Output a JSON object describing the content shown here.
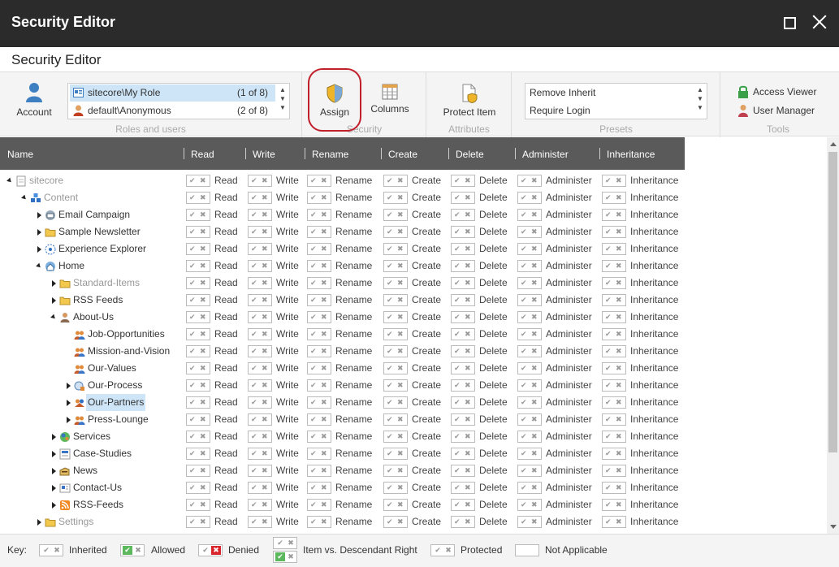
{
  "window": {
    "title": "Security Editor",
    "subtitle": "Security Editor"
  },
  "ribbon": {
    "account_label": "Account",
    "roles": [
      {
        "name": "sitecore\\My Role",
        "count": "(1 of 8)"
      },
      {
        "name": "default\\Anonymous",
        "count": "(2 of 8)"
      }
    ],
    "roles_group_label": "Roles and users",
    "assign_label": "Assign",
    "columns_label": "Columns",
    "security_group_label": "Security",
    "protect_item_label": "Protect Item",
    "attributes_group_label": "Attributes",
    "presets": [
      "Remove Inherit",
      "Require Login"
    ],
    "presets_group_label": "Presets",
    "access_viewer_label": "Access Viewer",
    "user_manager_label": "User Manager",
    "tools_group_label": "Tools"
  },
  "grid": {
    "headers": [
      "Name",
      "Read",
      "Write",
      "Rename",
      "Create",
      "Delete",
      "Administer",
      "Inheritance"
    ],
    "rows": [
      {
        "label": "sitecore",
        "depth": 0,
        "expander": "open",
        "icon": "document-icon",
        "style": "gray"
      },
      {
        "label": "Content",
        "depth": 1,
        "expander": "open",
        "icon": "content-tree-icon",
        "style": "gray"
      },
      {
        "label": "Email Campaign",
        "depth": 2,
        "expander": "closed",
        "icon": "email-icon",
        "style": "normal"
      },
      {
        "label": "Sample Newsletter",
        "depth": 2,
        "expander": "closed",
        "icon": "folder-icon",
        "style": "normal"
      },
      {
        "label": "Experience Explorer",
        "depth": 2,
        "expander": "closed",
        "icon": "explorer-icon",
        "style": "normal"
      },
      {
        "label": "Home",
        "depth": 2,
        "expander": "open",
        "icon": "home-icon",
        "style": "normal"
      },
      {
        "label": "Standard-Items",
        "depth": 3,
        "expander": "closed",
        "icon": "folder-icon",
        "style": "gray"
      },
      {
        "label": "RSS Feeds",
        "depth": 3,
        "expander": "closed",
        "icon": "folder-icon",
        "style": "normal"
      },
      {
        "label": "About-Us",
        "depth": 3,
        "expander": "open",
        "icon": "person-icon",
        "style": "normal"
      },
      {
        "label": "Job-Opportunities",
        "depth": 4,
        "expander": "none",
        "icon": "people-icon",
        "style": "normal"
      },
      {
        "label": "Mission-and-Vision",
        "depth": 4,
        "expander": "none",
        "icon": "people-icon",
        "style": "normal"
      },
      {
        "label": "Our-Values",
        "depth": 4,
        "expander": "none",
        "icon": "people-icon",
        "style": "normal"
      },
      {
        "label": "Our-Process",
        "depth": 4,
        "expander": "closed",
        "icon": "process-icon",
        "style": "normal"
      },
      {
        "label": "Our-Partners",
        "depth": 4,
        "expander": "closed",
        "icon": "partners-icon",
        "style": "selected"
      },
      {
        "label": "Press-Lounge",
        "depth": 4,
        "expander": "closed",
        "icon": "people-icon",
        "style": "normal"
      },
      {
        "label": "Services",
        "depth": 3,
        "expander": "closed",
        "icon": "services-icon",
        "style": "normal"
      },
      {
        "label": "Case-Studies",
        "depth": 3,
        "expander": "closed",
        "icon": "case-icon",
        "style": "normal"
      },
      {
        "label": "News",
        "depth": 3,
        "expander": "closed",
        "icon": "news-icon",
        "style": "normal"
      },
      {
        "label": "Contact-Us",
        "depth": 3,
        "expander": "closed",
        "icon": "contact-icon",
        "style": "normal"
      },
      {
        "label": "RSS-Feeds",
        "depth": 3,
        "expander": "closed",
        "icon": "rss-icon",
        "style": "normal"
      },
      {
        "label": "Settings",
        "depth": 2,
        "expander": "closed",
        "icon": "folder-icon",
        "style": "gray"
      }
    ]
  },
  "footer": {
    "key_label": "Key:",
    "inherited": "Inherited",
    "allowed": "Allowed",
    "denied": "Denied",
    "item_vs_descendant": "Item vs. Descendant Right",
    "protected": "Protected",
    "not_applicable": "Not Applicable"
  },
  "colors": {
    "titlebar": "#2b2b2b",
    "header": "#5a5a5a",
    "selection": "#cde5f7",
    "highlight": "#c0202a",
    "allowed": "#5cb85c",
    "denied": "#d9262c"
  }
}
